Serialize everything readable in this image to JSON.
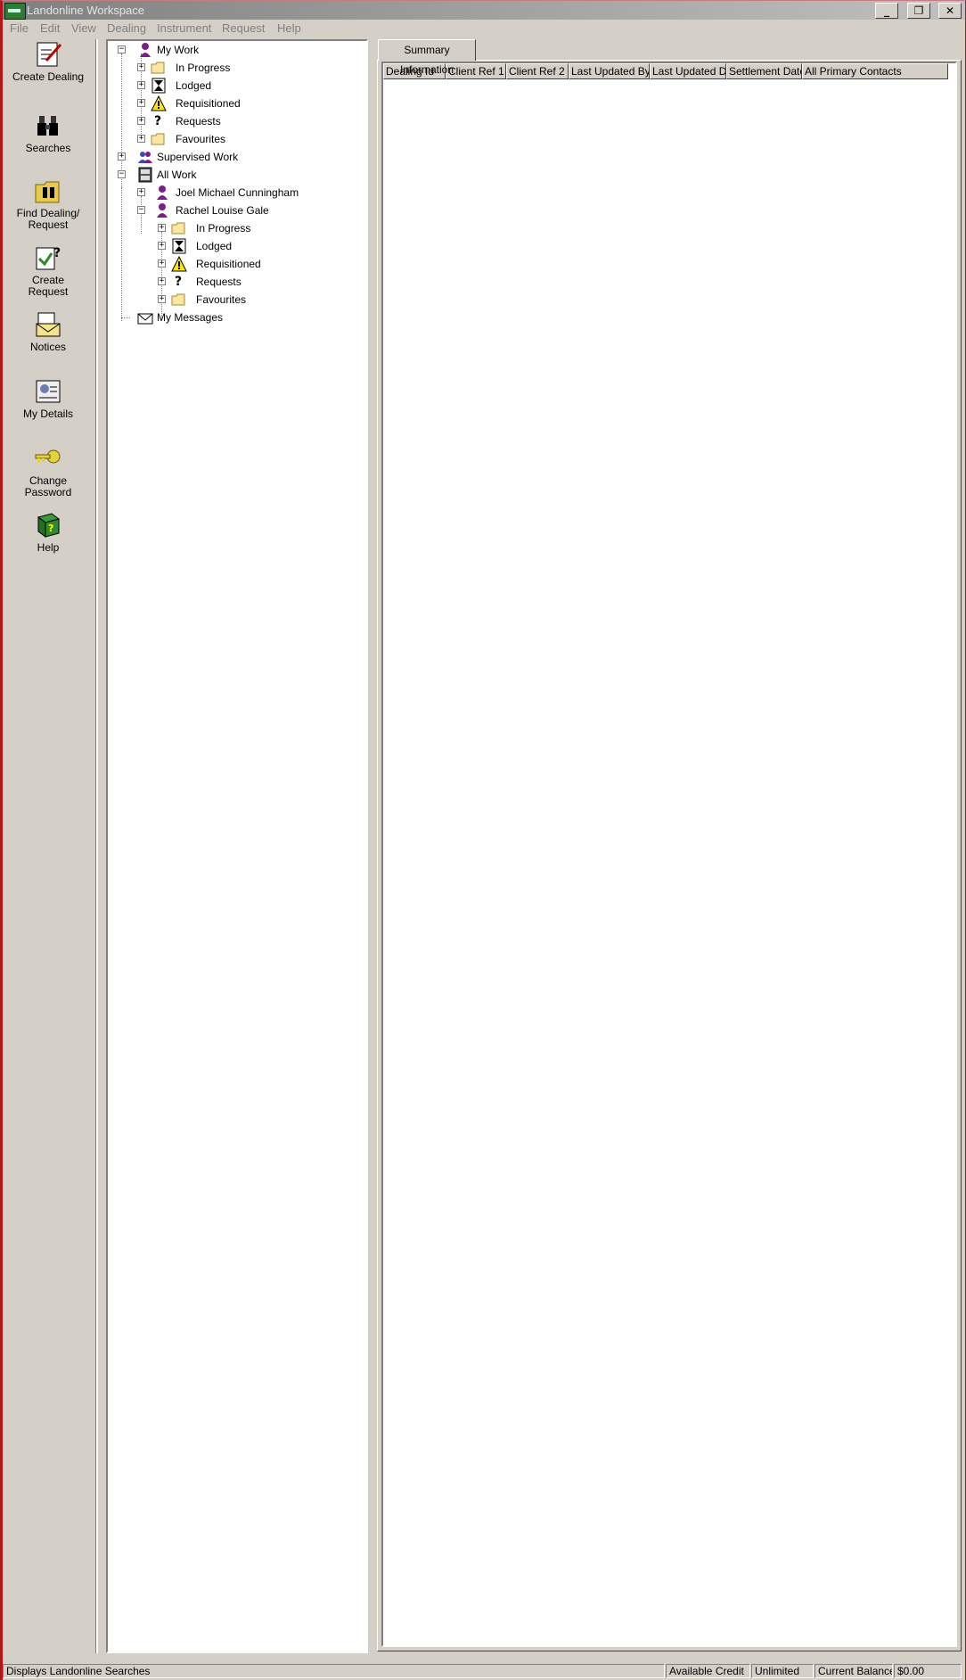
{
  "window": {
    "title": "Landonline Workspace"
  },
  "menu": [
    "File",
    "Edit",
    "View",
    "Dealing",
    "Instrument",
    "Request",
    "Help"
  ],
  "toolbar": {
    "create_dealing": "Create Dealing",
    "searches": "Searches",
    "find_dealing_1": "Find Dealing/",
    "find_dealing_2": "Request",
    "create_request_1": "Create",
    "create_request_2": "Request",
    "notices": "Notices",
    "my_details": "My Details",
    "change_password_1": "Change",
    "change_password_2": "Password",
    "help": "Help"
  },
  "tree": {
    "my_work": "My Work",
    "in_progress": "In Progress",
    "lodged": "Lodged",
    "requisitioned": "Requisitioned",
    "requests": "Requests",
    "favourites": "Favourites",
    "supervised_work": "Supervised Work",
    "all_work": "All Work",
    "user1": "Joel Michael Cunningham",
    "user2": "Rachel Louise Gale",
    "my_messages": "My Messages"
  },
  "tab": {
    "label": "Summary Information"
  },
  "columns": [
    "Dealing Id",
    "Client Ref 1",
    "Client Ref 2",
    "Last Updated By",
    "Last Updated Dat",
    "Settlement Date",
    "All Primary Contacts"
  ],
  "status": {
    "message": "Displays Landonline Searches",
    "credit_label": "Available Credit",
    "credit_value": "Unlimited",
    "balance_label": "Current Balance",
    "balance_value": "$0.00"
  }
}
